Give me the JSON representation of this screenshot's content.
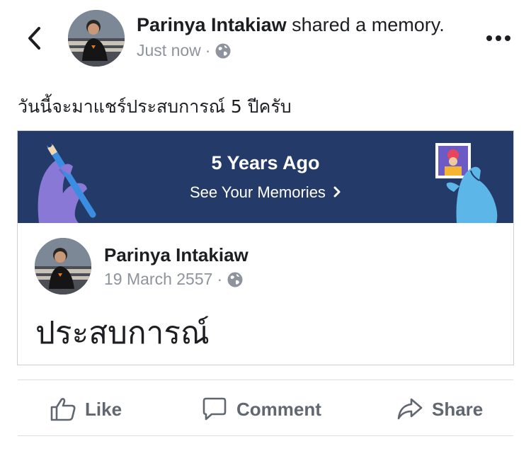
{
  "header": {
    "author": "Parinya Intakiaw",
    "action": "shared a memory.",
    "time": "Just now",
    "separator": "·",
    "back_icon": "chevron-left-icon",
    "more_icon": "more-dots-icon",
    "privacy_icon": "globe-icon"
  },
  "post": {
    "caption": "วันนี้จะมาแชร์ประสบการณ์ 5 ปีครับ"
  },
  "memory": {
    "banner_title": "5 Years Ago",
    "banner_link": "See Your Memories",
    "banner_link_icon": "chevron-right-icon",
    "banner_color": "#243a68",
    "original_post": {
      "author": "Parinya Intakiaw",
      "date": "19 March 2557",
      "separator": "·",
      "text": "ประสบการณ์"
    }
  },
  "actions": {
    "like": "Like",
    "comment": "Comment",
    "share": "Share"
  },
  "colors": {
    "text": "#1c1e21",
    "muted": "#8d949e",
    "action": "#606770",
    "divider": "#dadde1"
  }
}
